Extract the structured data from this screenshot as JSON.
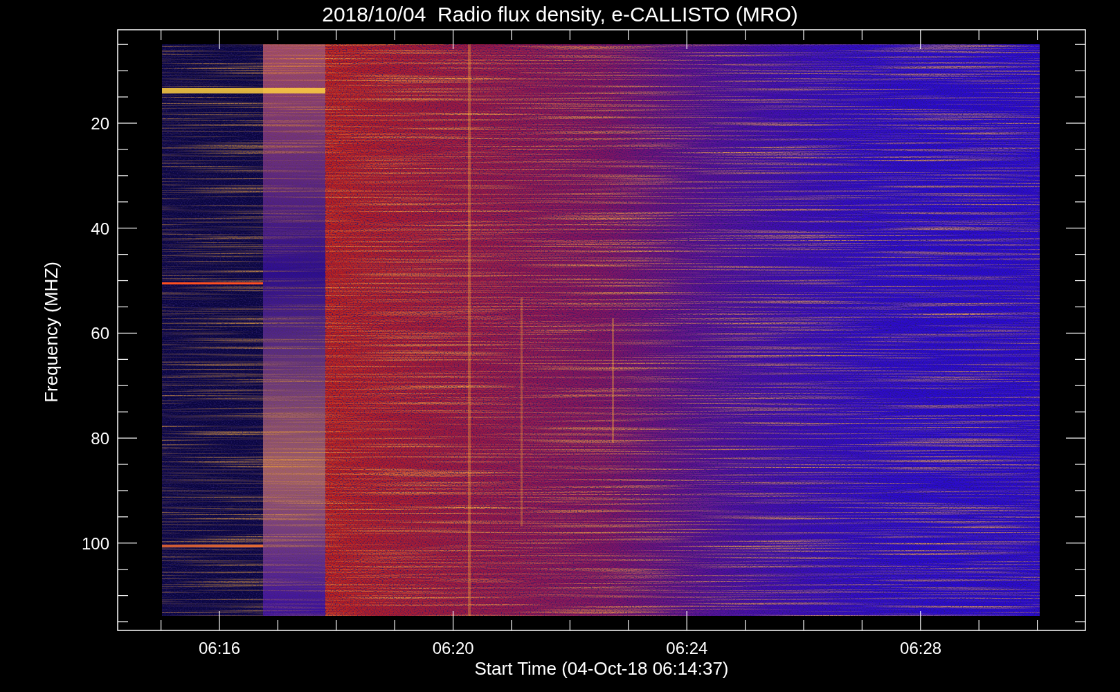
{
  "title": "2018/10/04  Radio flux density, e-CALLISTO (MRO)",
  "y_axis": {
    "label": "Frequency (MHZ)",
    "ticks": [
      "20",
      "40",
      "60",
      "80",
      "100"
    ]
  },
  "x_axis": {
    "label": "Start Time (04-Oct-18 06:14:37)",
    "ticks": [
      "06:16",
      "06:20",
      "06:24",
      "06:28"
    ]
  }
}
